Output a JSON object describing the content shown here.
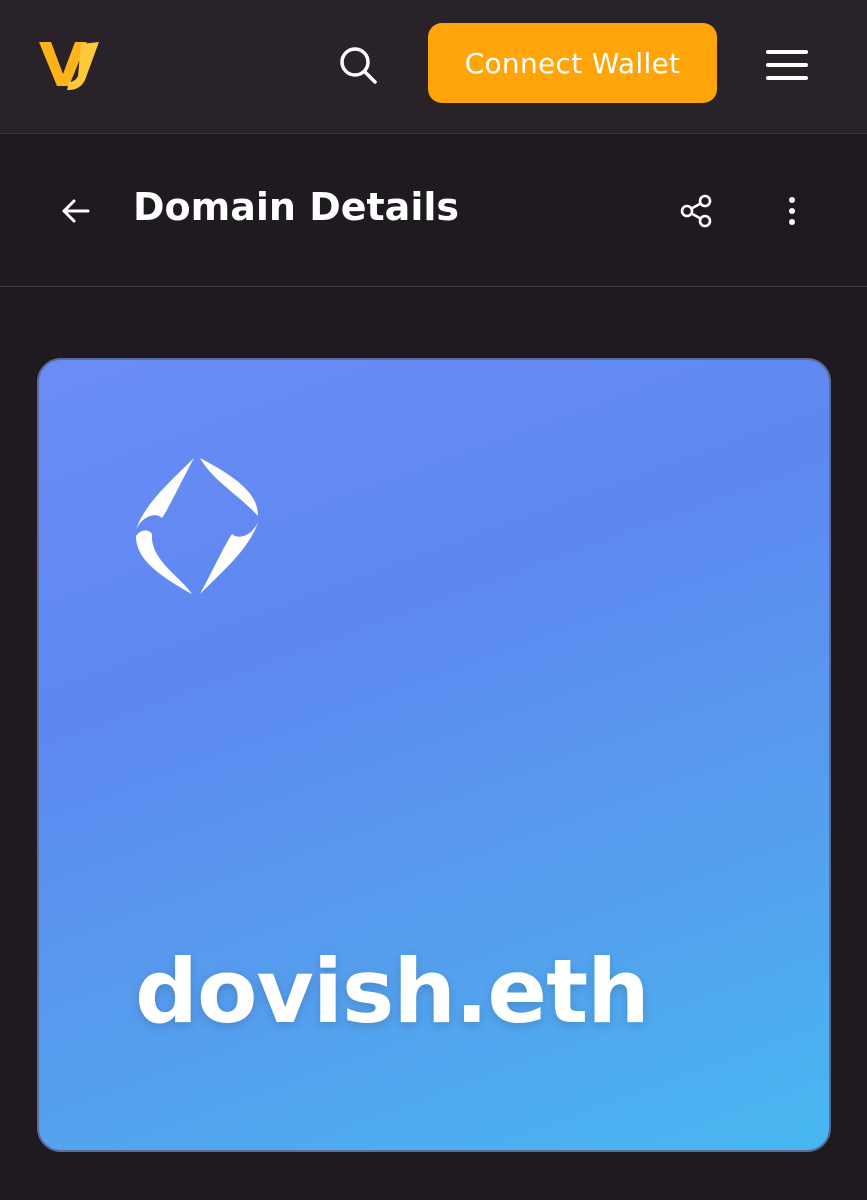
{
  "header": {
    "logo_icon": "vj-logo-icon",
    "search_icon": "search-icon",
    "connect_label": "Connect Wallet",
    "menu_icon": "hamburger-menu-icon",
    "accent_color": "#ffa50a"
  },
  "subheader": {
    "back_icon": "arrow-left-icon",
    "title": "Domain Details",
    "share_icon": "share-icon",
    "more_icon": "more-vertical-icon"
  },
  "card": {
    "logo_icon": "ens-logo-icon",
    "domain": "dovish.eth",
    "gradient_start": "#6b8cf5",
    "gradient_end": "#47b8f0"
  }
}
